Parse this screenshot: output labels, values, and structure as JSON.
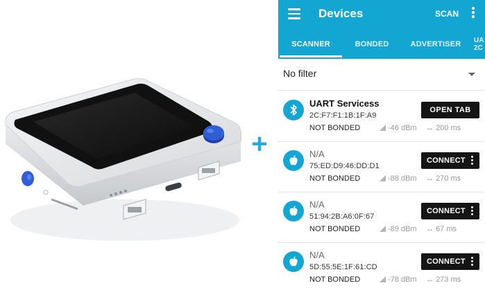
{
  "app": {
    "title": "Devices",
    "scan_label": "SCAN",
    "tabs": [
      {
        "label": "SCANNER",
        "active": true
      },
      {
        "label": "BONDED",
        "active": false
      },
      {
        "label": "ADVERTISER",
        "active": false
      }
    ],
    "partial_tab": {
      "line1": "UA",
      "line2": "2C"
    },
    "filter": "No filter",
    "devices": [
      {
        "name": "UART Servicess",
        "mac": "2C:F7:F1:1B:1F:A9",
        "bond": "NOT BONDED",
        "rssi": "-46 dBm",
        "interval": "200 ms",
        "action": "OPEN TAB",
        "icon": "bluetooth-icon"
      },
      {
        "name": "N/A",
        "mac": "75:ED:D9:46:DD:D1",
        "bond": "NOT BONDED",
        "rssi": "-88 dBm",
        "interval": "270 ms",
        "action": "CONNECT",
        "icon": "apple-icon"
      },
      {
        "name": "N/A",
        "mac": "51:94:2B:A6:0F:67",
        "bond": "NOT BONDED",
        "rssi": "-89 dBm",
        "interval": "67 ms",
        "action": "CONNECT",
        "icon": "apple-icon"
      },
      {
        "name": "N/A",
        "mac": "5D:55:5E:1F:61:CD",
        "bond": "NOT BONDED",
        "rssi": "-78 dBm",
        "interval": "273 ms",
        "action": "CONNECT",
        "icon": "apple-icon"
      }
    ]
  },
  "colors": {
    "appbar": "#14a6d2",
    "plus": "#2aa7e0",
    "button": "#151515",
    "device_button_blue": "#2f5fd6"
  },
  "separator_glyph": "+"
}
